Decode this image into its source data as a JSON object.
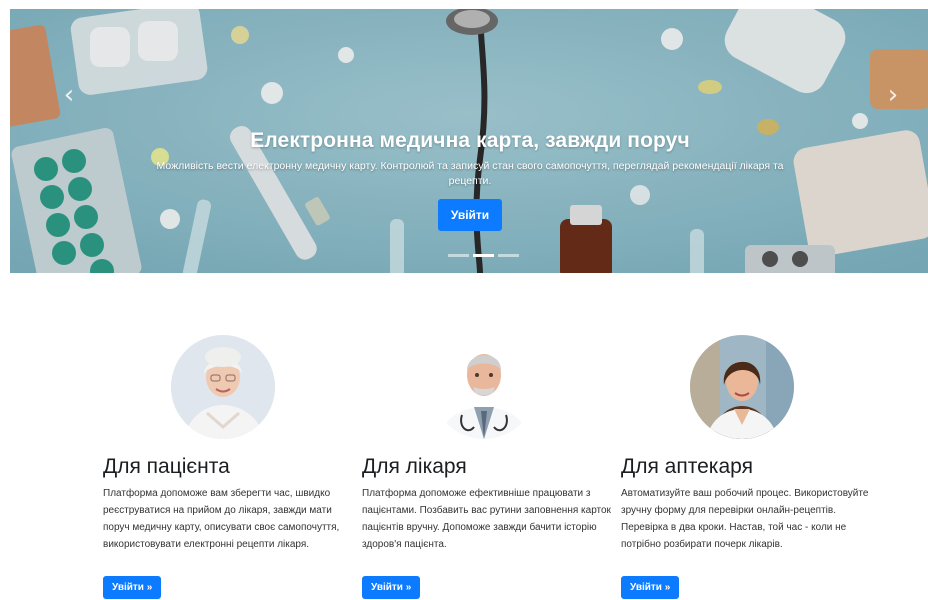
{
  "hero": {
    "title": "Електронна медична карта, завжди поруч",
    "text": "Можливість вести електронну медичну карту. Контролюй та записуй стан свого самопочуття, переглядай рекомендації лікаря та рецепти.",
    "button_label": "Увійти",
    "prev_icon": "‹",
    "next_icon": "›",
    "slides_count": 3,
    "active_slide": 2
  },
  "features": [
    {
      "title": "Для пацієнта",
      "text": "Платформа допоможе вам зберегти час, швидко реєструватися на прийом до лікаря, завжди мати поруч медичну карту, описувати своє самопочуття, використовувати електронні рецепти лікаря.",
      "button_label": "Увійти »"
    },
    {
      "title": "Для лікаря",
      "text": "Платформа допоможе ефективніше працювати з пацієнтами. Позбавить вас рутини заповнення карток пацієнтів вручну. Допоможе завжди бачити історію здоров'я пацієнта.",
      "button_label": "Увійти »"
    },
    {
      "title": "Для аптекаря",
      "text": "Автоматизуйте ваш робочий процес. Використовуйте зручну форму для перевірки онлайн-рецептів. Перевірка в два кроки. Настав, той час - коли не потрібно розбирати почерк лікарів.",
      "button_label": "Увійти »"
    }
  ],
  "colors": {
    "accent": "#0d7bff",
    "hero_bg": "#8fc0cd"
  }
}
